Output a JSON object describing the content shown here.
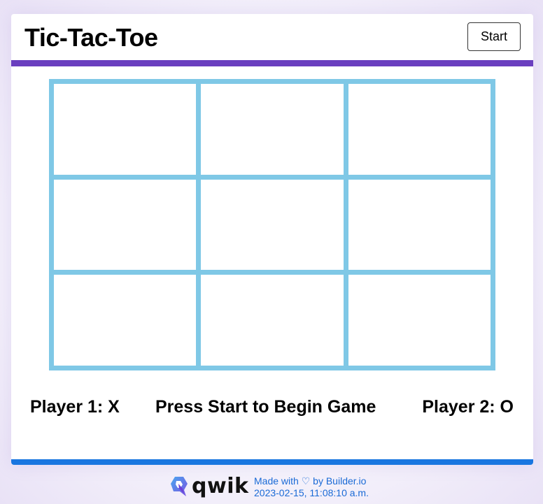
{
  "header": {
    "title": "Tic-Tac-Toe",
    "start_label": "Start"
  },
  "board": {
    "cells": [
      "",
      "",
      "",
      "",
      "",
      "",
      "",
      "",
      ""
    ]
  },
  "status": {
    "player1": "Player 1: X",
    "message": "Press Start to Begin Game",
    "player2": "Player 2: O"
  },
  "footer": {
    "logo_text": "qwik",
    "made_prefix": "Made with",
    "heart": "♡",
    "made_by": "by",
    "builder_link": "Builder.io",
    "timestamp": "2023-02-15, 11:08:10 a.m."
  },
  "colors": {
    "header_rule": "#6a3fbf",
    "board_grid": "#7fc8e6",
    "bottom_rule": "#1976e0",
    "footer_text": "#1a6ad6"
  }
}
